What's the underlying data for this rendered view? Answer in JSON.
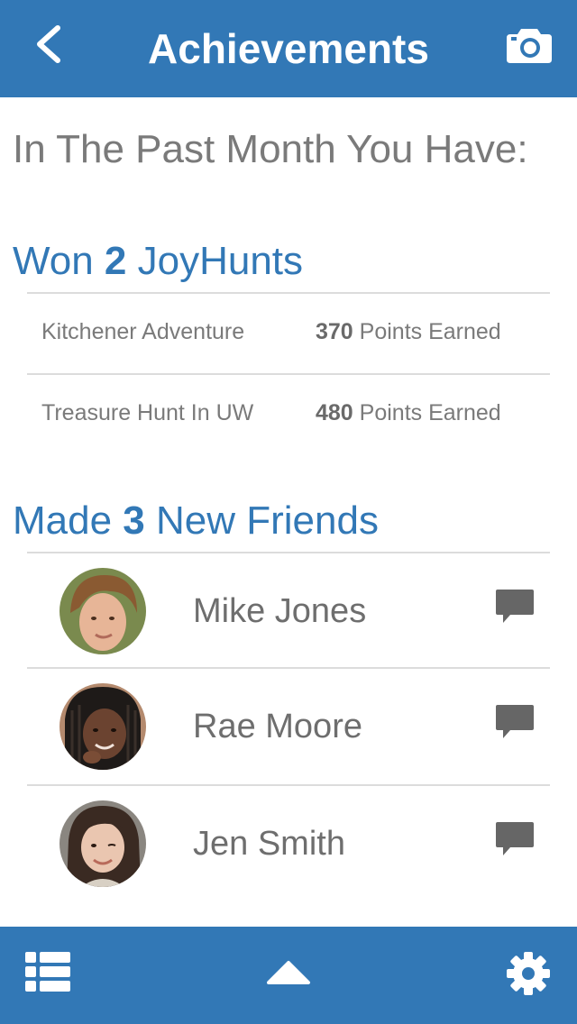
{
  "header": {
    "title": "Achievements",
    "back_icon": "chevron-left-icon",
    "camera_icon": "camera-icon",
    "color": "#3278b6"
  },
  "intro": "In The Past Month You Have:",
  "hunts_section": {
    "prefix": "Won ",
    "count": "2",
    "suffix": " JoyHunts",
    "items": [
      {
        "name": "Kitchener Adventure",
        "points": "370",
        "points_label": " Points Earned"
      },
      {
        "name": "Treasure Hunt In UW",
        "points": "480",
        "points_label": " Points Earned"
      }
    ]
  },
  "friends_section": {
    "prefix": "Made ",
    "count": "3",
    "suffix": " New Friends",
    "items": [
      {
        "name": "Mike Jones",
        "avatar": "avatar-boy",
        "chat_icon": "chat-bubble-icon"
      },
      {
        "name": "Rae Moore",
        "avatar": "avatar-girl-braids",
        "chat_icon": "chat-bubble-icon"
      },
      {
        "name": "Jen Smith",
        "avatar": "avatar-girl",
        "chat_icon": "chat-bubble-icon"
      }
    ]
  },
  "bottom_bar": {
    "list_icon": "list-icon",
    "up_icon": "triangle-up-icon",
    "settings_icon": "gear-icon"
  }
}
